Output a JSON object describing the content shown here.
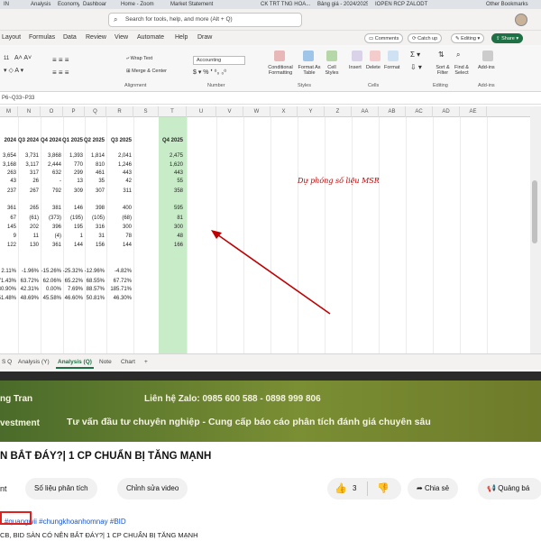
{
  "browser_tabs": [
    {
      "label": "IN"
    },
    {
      "label": "Analysis"
    },
    {
      "label": "Economy"
    },
    {
      "label": "Dashboard"
    },
    {
      "label": "Home - Zoom"
    },
    {
      "label": "Market Statement"
    },
    {
      "label": "CK TRT TNG HOA..."
    },
    {
      "label": "Bảng giá - 2024/2025"
    },
    {
      "label": "IOPEN RCP ZALODT"
    },
    {
      "label": "Other Bookmarks"
    }
  ],
  "search": {
    "placeholder": "Search for tools, help, and more (Alt + Q)"
  },
  "menu": [
    "Layout",
    "Formulas",
    "Data",
    "Review",
    "View",
    "Automate",
    "Help",
    "Draw"
  ],
  "menu_right": {
    "comments": "Comments",
    "catchup": "Catch up",
    "editing": "Editing",
    "share": "Share"
  },
  "ribbon": {
    "font_size": "11",
    "wrap_text": "Wrap Text",
    "merge_center": "Merge & Center",
    "number_format": "Accounting",
    "cond_format": "Conditional Formatting",
    "format_table": "Format As Table",
    "cell_styles": "Cell Styles",
    "insert": "Insert",
    "delete": "Delete",
    "format": "Format",
    "sort_filter": "Sort & Filter",
    "find_select": "Find & Select",
    "addins": "Add-ins",
    "groups": [
      "Alignment",
      "Number",
      "Styles",
      "Cells",
      "Editing",
      "Add-ins"
    ]
  },
  "formula_bar": {
    "ref": "P6~Q33~P33"
  },
  "column_headers": [
    "M",
    "N",
    "O",
    "P",
    "Q",
    "R",
    "S",
    "T",
    "U",
    "V",
    "W",
    "X",
    "Y",
    "Z",
    "AA",
    "AB",
    "AC",
    "AD",
    "AE"
  ],
  "grid_header_row": [
    "2024",
    "Q3 2024",
    "Q4 2024",
    "Q1 2025",
    "Q2 2025",
    "Q3 2025",
    "Q4 2025"
  ],
  "grid_rows": [
    [
      "3,654",
      "3,731",
      "3,868",
      "1,393",
      "1,814",
      "2,041",
      "2,475"
    ],
    [
      "3,168",
      "3,117",
      "2,444",
      "770",
      "810",
      "1,246",
      "1,620"
    ],
    [
      "263",
      "317",
      "632",
      "299",
      "461",
      "443",
      "443"
    ],
    [
      "43",
      "26",
      "-",
      "13",
      "35",
      "42",
      "55"
    ],
    [
      "237",
      "267",
      "792",
      "309",
      "307",
      "311",
      "358"
    ],
    [
      "",
      "",
      "",
      "",
      "",
      "",
      ""
    ],
    [
      "361",
      "265",
      "381",
      "146",
      "398",
      "400",
      "595"
    ],
    [
      "67",
      "(61)",
      "(373)",
      "(195)",
      "(105)",
      "(68)",
      "81"
    ],
    [
      "145",
      "202",
      "396",
      "195",
      "316",
      "300",
      "300"
    ],
    [
      "9",
      "11",
      "(4)",
      "1",
      "31",
      "78",
      "48"
    ],
    [
      "122",
      "130",
      "361",
      "144",
      "156",
      "144",
      "166"
    ],
    [
      "",
      "",
      "",
      "",
      "",
      "",
      ""
    ],
    [
      "",
      "",
      "",
      "",
      "",
      "",
      ""
    ],
    [
      "2.11%",
      "-1.96%",
      "-15.26%",
      "-25.32%",
      "-12.96%",
      "-4.82%",
      ""
    ],
    [
      "71.43%",
      "63.72%",
      "62.06%",
      "65.22%",
      "68.55%",
      "67.72%",
      ""
    ],
    [
      "30.90%",
      "42.31%",
      "0.00%",
      "7.69%",
      "88.57%",
      "185.71%",
      ""
    ],
    [
      "51.48%",
      "48.69%",
      "45.58%",
      "46.60%",
      "50.81%",
      "46.30%",
      ""
    ]
  ],
  "annotation": "Dự phóng số liệu MSR",
  "sheet_tabs": [
    "S Q",
    "Analysis (Y)",
    "Analysis (Q)",
    "Note",
    "Chart",
    "+"
  ],
  "active_sheet": "Analysis (Q)",
  "banner": {
    "name": "ng Tran",
    "contact": "Liên hệ Zalo: 0985 600 588 - 0898 999 806",
    "company": "vestment",
    "tagline": "Tư vấn đầu tư chuyên nghiệp - Cung cấp báo cáo phân tích đánh giá chuyên sâu"
  },
  "video": {
    "title": "N BẮT ĐÁY?| 1 CP CHUẨN BỊ TĂNG MẠNH",
    "channel_fragment": "nt",
    "btn_data": "Số liệu phân tích",
    "btn_edit": "Chỉnh sửa video",
    "likes": "3",
    "share": "Chia sẻ",
    "ads": "Quảng bá",
    "tags": "#quangwii #chungkhoanhomnay #BID",
    "desc_prefix": "·",
    "desc2": "CB, BID SÀN CÓ NÊN BẮT ĐÁY?| 1 CP CHUẨN BỊ TĂNG MẠNH"
  },
  "colors": {
    "excel_green": "#1e7145",
    "highlight": "#c9ecc8",
    "annotation": "#c00000",
    "tag": "#1a56c4"
  }
}
